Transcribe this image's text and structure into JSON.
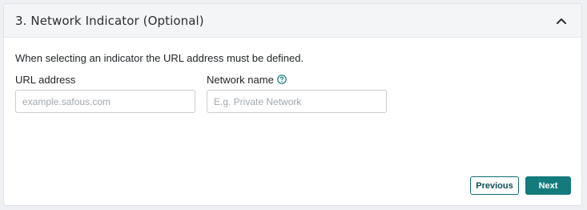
{
  "section": {
    "title": "3. Network Indicator (Optional)",
    "collapse_icon": "chevron-up-icon"
  },
  "body": {
    "info": "When selecting an indicator the URL address must be defined."
  },
  "fields": {
    "url": {
      "label": "URL address",
      "placeholder": "example.safous.com",
      "value": ""
    },
    "network_name": {
      "label": "Network name",
      "placeholder": "E.g. Private Network",
      "value": "",
      "help_icon": "help-circle-icon"
    }
  },
  "actions": {
    "previous_label": "Previous",
    "next_label": "Next"
  },
  "colors": {
    "accent": "#137b7c",
    "help_icon": "#137b7c"
  }
}
